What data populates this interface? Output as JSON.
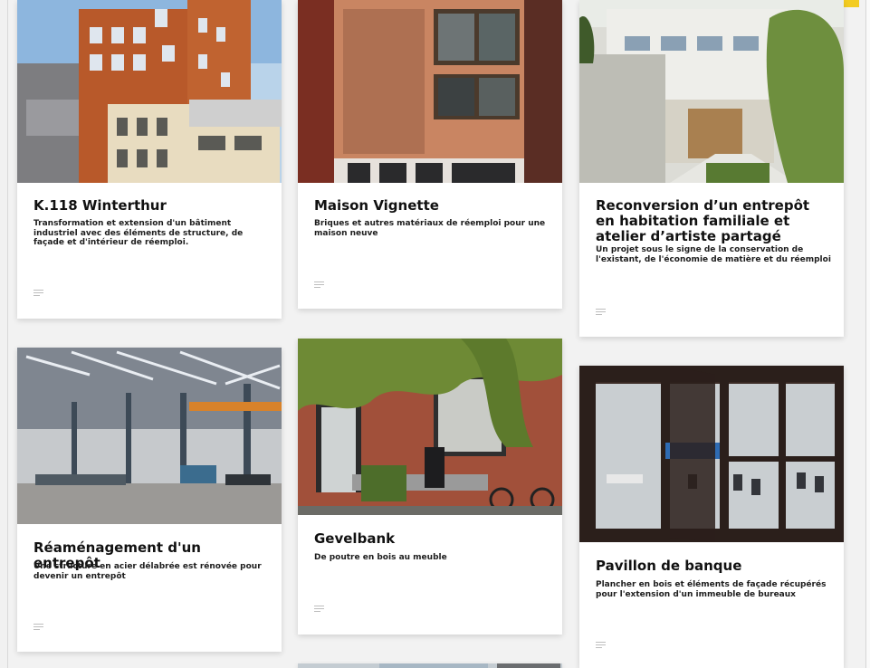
{
  "colors": {
    "accent": "#f3cc21",
    "card_bg": "#ffffff",
    "page_bg": "#f2f2f2"
  },
  "cards": [
    {
      "title": "K.118 Winterthur",
      "description": "Transformation et extension d'un bâtiment industriel avec des éléments de structure, de façade et d'intérieur de réemploi.",
      "icon": "text-lines-icon"
    },
    {
      "title": "Maison Vignette",
      "description": "Briques et autres matériaux de réemploi pour une maison neuve",
      "icon": "text-lines-icon"
    },
    {
      "title": "Reconversion d’un entrepôt en habitation familiale et atelier d’artiste partagé",
      "description": "Un projet sous le signe de la conservation de l'existant, de l'économie de matière et du réemploi",
      "icon": "text-lines-icon"
    },
    {
      "title": "Réaménagement d'un entrepôt",
      "description": "Une structure en acier délabrée est rénovée pour devenir un entrepôt",
      "icon": "text-lines-icon"
    },
    {
      "title": "Gevelbank",
      "description": "De poutre en bois au meuble",
      "icon": "text-lines-icon"
    },
    {
      "title": "Pavillon de banque",
      "description": "Plancher en bois et éléments de façade récupérés pour l'extension d'un immeuble de bureaux",
      "icon": "text-lines-icon"
    }
  ]
}
